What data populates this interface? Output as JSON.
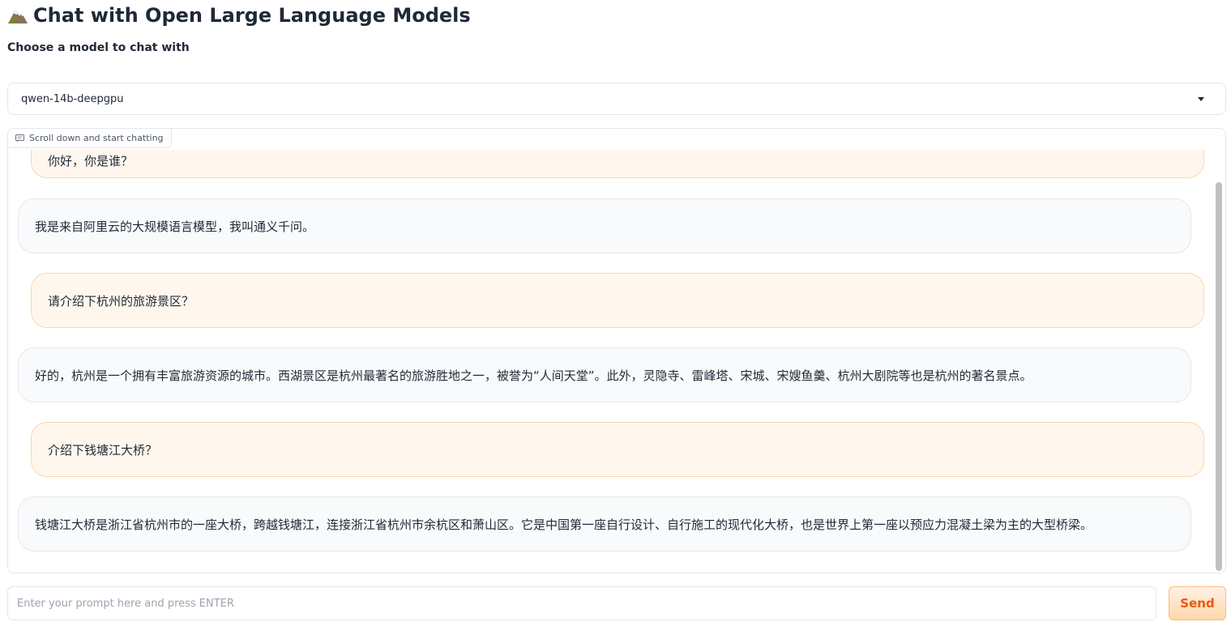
{
  "header": {
    "title": "Chat with Open Large Language Models",
    "icon": "mountain-icon"
  },
  "model_select": {
    "label": "Choose a model to chat with",
    "selected": "qwen-14b-deepgpu"
  },
  "chatbot": {
    "label": "Scroll down and start chatting",
    "messages": [
      {
        "role": "user",
        "text": "你好，你是谁？"
      },
      {
        "role": "bot",
        "text": "我是来自阿里云的大规模语言模型，我叫通义千问。"
      },
      {
        "role": "user",
        "text": "请介绍下杭州的旅游景区？"
      },
      {
        "role": "bot",
        "text": "好的，杭州是一个拥有丰富旅游资源的城市。西湖景区是杭州最著名的旅游胜地之一，被誉为“人间天堂”。此外，灵隐寺、雷峰塔、宋城、宋嫂鱼羹、杭州大剧院等也是杭州的著名景点。"
      },
      {
        "role": "user",
        "text": "介绍下钱塘江大桥？"
      },
      {
        "role": "bot",
        "text": "钱塘江大桥是浙江省杭州市的一座大桥，跨越钱塘江，连接浙江省杭州市余杭区和萧山区。它是中国第一座自行设计、自行施工的现代化大桥，也是世界上第一座以预应力混凝土梁为主的大型桥梁。"
      }
    ]
  },
  "prompt": {
    "placeholder": "Enter your prompt here and press ENTER",
    "value": ""
  },
  "send_label": "Send",
  "colors": {
    "user_bubble": "#fff7ed",
    "user_border": "#fed7aa",
    "bot_bubble": "#f9fafb",
    "accent": "#ea580c"
  }
}
